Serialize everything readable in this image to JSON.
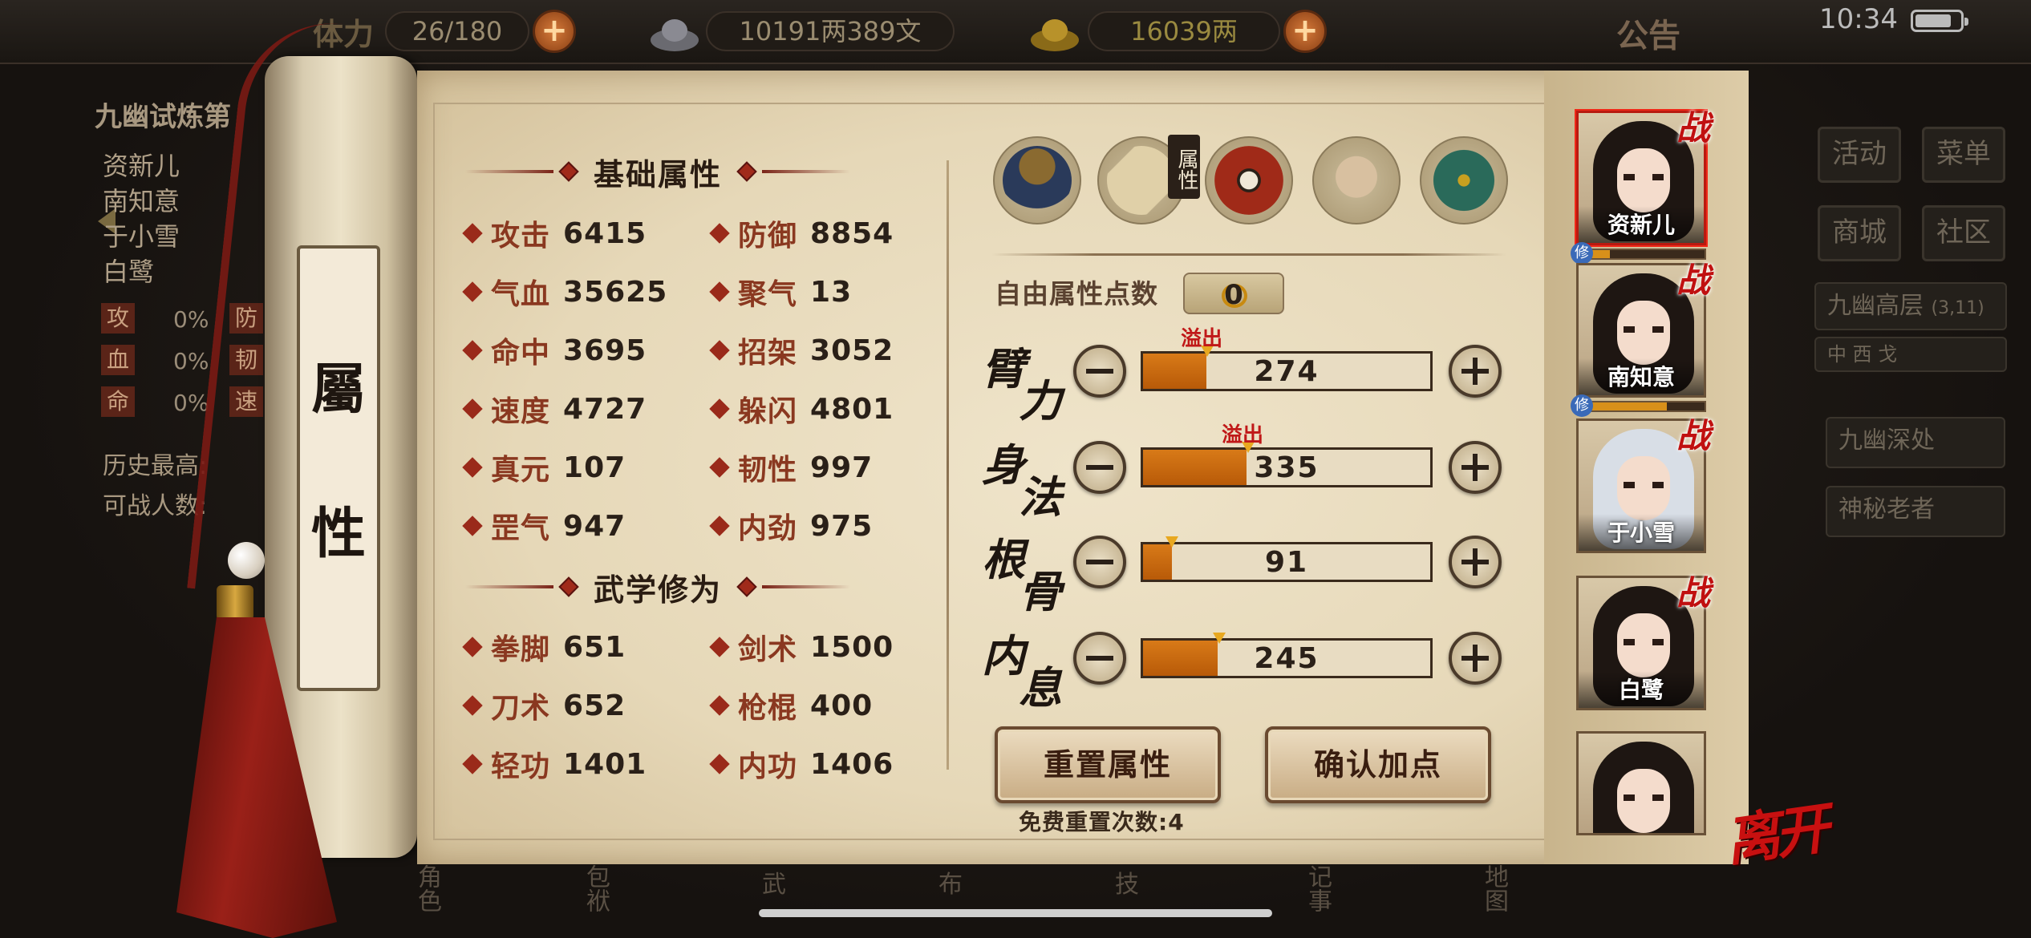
{
  "topbar": {
    "physical_label": "体力",
    "physical": "26/180",
    "silver": "10191两389文",
    "gold": "16039两",
    "notice": "公告",
    "time": "10:34"
  },
  "left_panel": {
    "title": "九幽试炼第",
    "names": [
      "资新儿",
      "南知意",
      "于小雪",
      "白鹭"
    ],
    "stats": [
      {
        "chip": "攻",
        "pct": "0%",
        "chip2": "防"
      },
      {
        "chip": "血",
        "pct": "0%",
        "chip2": "韧"
      },
      {
        "chip": "命",
        "pct": "0%",
        "chip2": "速"
      }
    ],
    "history_label": "历史最高:",
    "fighters_label": "可战人数:"
  },
  "right_menu": {
    "activity": "活动",
    "menu": "菜单",
    "shop": "商城",
    "community": "社区",
    "floor": "九幽高层",
    "floor_coord": "(3,11)",
    "dirs": "中 西 戈",
    "deep": "九幽深处",
    "elder": "神秘老者"
  },
  "bottom_nav": [
    "角色",
    "包袱",
    "武",
    "布",
    "技",
    "记事",
    "地图"
  ],
  "scroll_label": [
    "屬",
    "性"
  ],
  "basic": {
    "title": "基础属性",
    "attrs": [
      {
        "label": "攻击",
        "value": "6415"
      },
      {
        "label": "防御",
        "value": "8854"
      },
      {
        "label": "气血",
        "value": "35625"
      },
      {
        "label": "聚气",
        "value": "13"
      },
      {
        "label": "命中",
        "value": "3695"
      },
      {
        "label": "招架",
        "value": "3052"
      },
      {
        "label": "速度",
        "value": "4727"
      },
      {
        "label": "躲闪",
        "value": "4801"
      },
      {
        "label": "真元",
        "value": "107"
      },
      {
        "label": "韧性",
        "value": "997"
      },
      {
        "label": "罡气",
        "value": "947"
      },
      {
        "label": "内劲",
        "value": "975"
      }
    ]
  },
  "martial": {
    "title": "武学修为",
    "attrs": [
      {
        "label": "拳脚",
        "value": "651"
      },
      {
        "label": "剑术",
        "value": "1500"
      },
      {
        "label": "刀术",
        "value": "652"
      },
      {
        "label": "枪棍",
        "value": "400"
      },
      {
        "label": "轻功",
        "value": "1401"
      },
      {
        "label": "内功",
        "value": "1406"
      }
    ]
  },
  "tabs": {
    "active_tag": "属性",
    "icons": [
      "hat-character-icon",
      "scroll-map-icon",
      "bagua-icon",
      "muscle-icon",
      "compass-icon"
    ]
  },
  "points": {
    "free_label": "自由属性点数",
    "free_value": "0",
    "overflow_label": "溢出",
    "items": [
      {
        "name": "臂力",
        "value": "274",
        "fill": 0.22,
        "overflow": true
      },
      {
        "name": "身法",
        "value": "335",
        "fill": 0.36,
        "overflow": true
      },
      {
        "name": "根骨",
        "value": "91",
        "fill": 0.1,
        "overflow": false
      },
      {
        "name": "内息",
        "value": "245",
        "fill": 0.26,
        "overflow": false
      }
    ],
    "reset_button": "重置属性",
    "confirm_button": "确认加点",
    "reset_count": "免费重置次数:4"
  },
  "roster": {
    "war_tag": "战",
    "xiu_tag": "修",
    "characters": [
      {
        "name": "资新儿",
        "active": true
      },
      {
        "name": "南知意",
        "active": false
      },
      {
        "name": "于小雪",
        "active": false
      },
      {
        "name": "白鹭",
        "active": false
      },
      {
        "name": "",
        "active": false
      }
    ]
  },
  "leave": "离开",
  "colors": {
    "accent": "#9a2a1a",
    "bar_fill": "#d87a18",
    "overflow": "#c01818"
  }
}
